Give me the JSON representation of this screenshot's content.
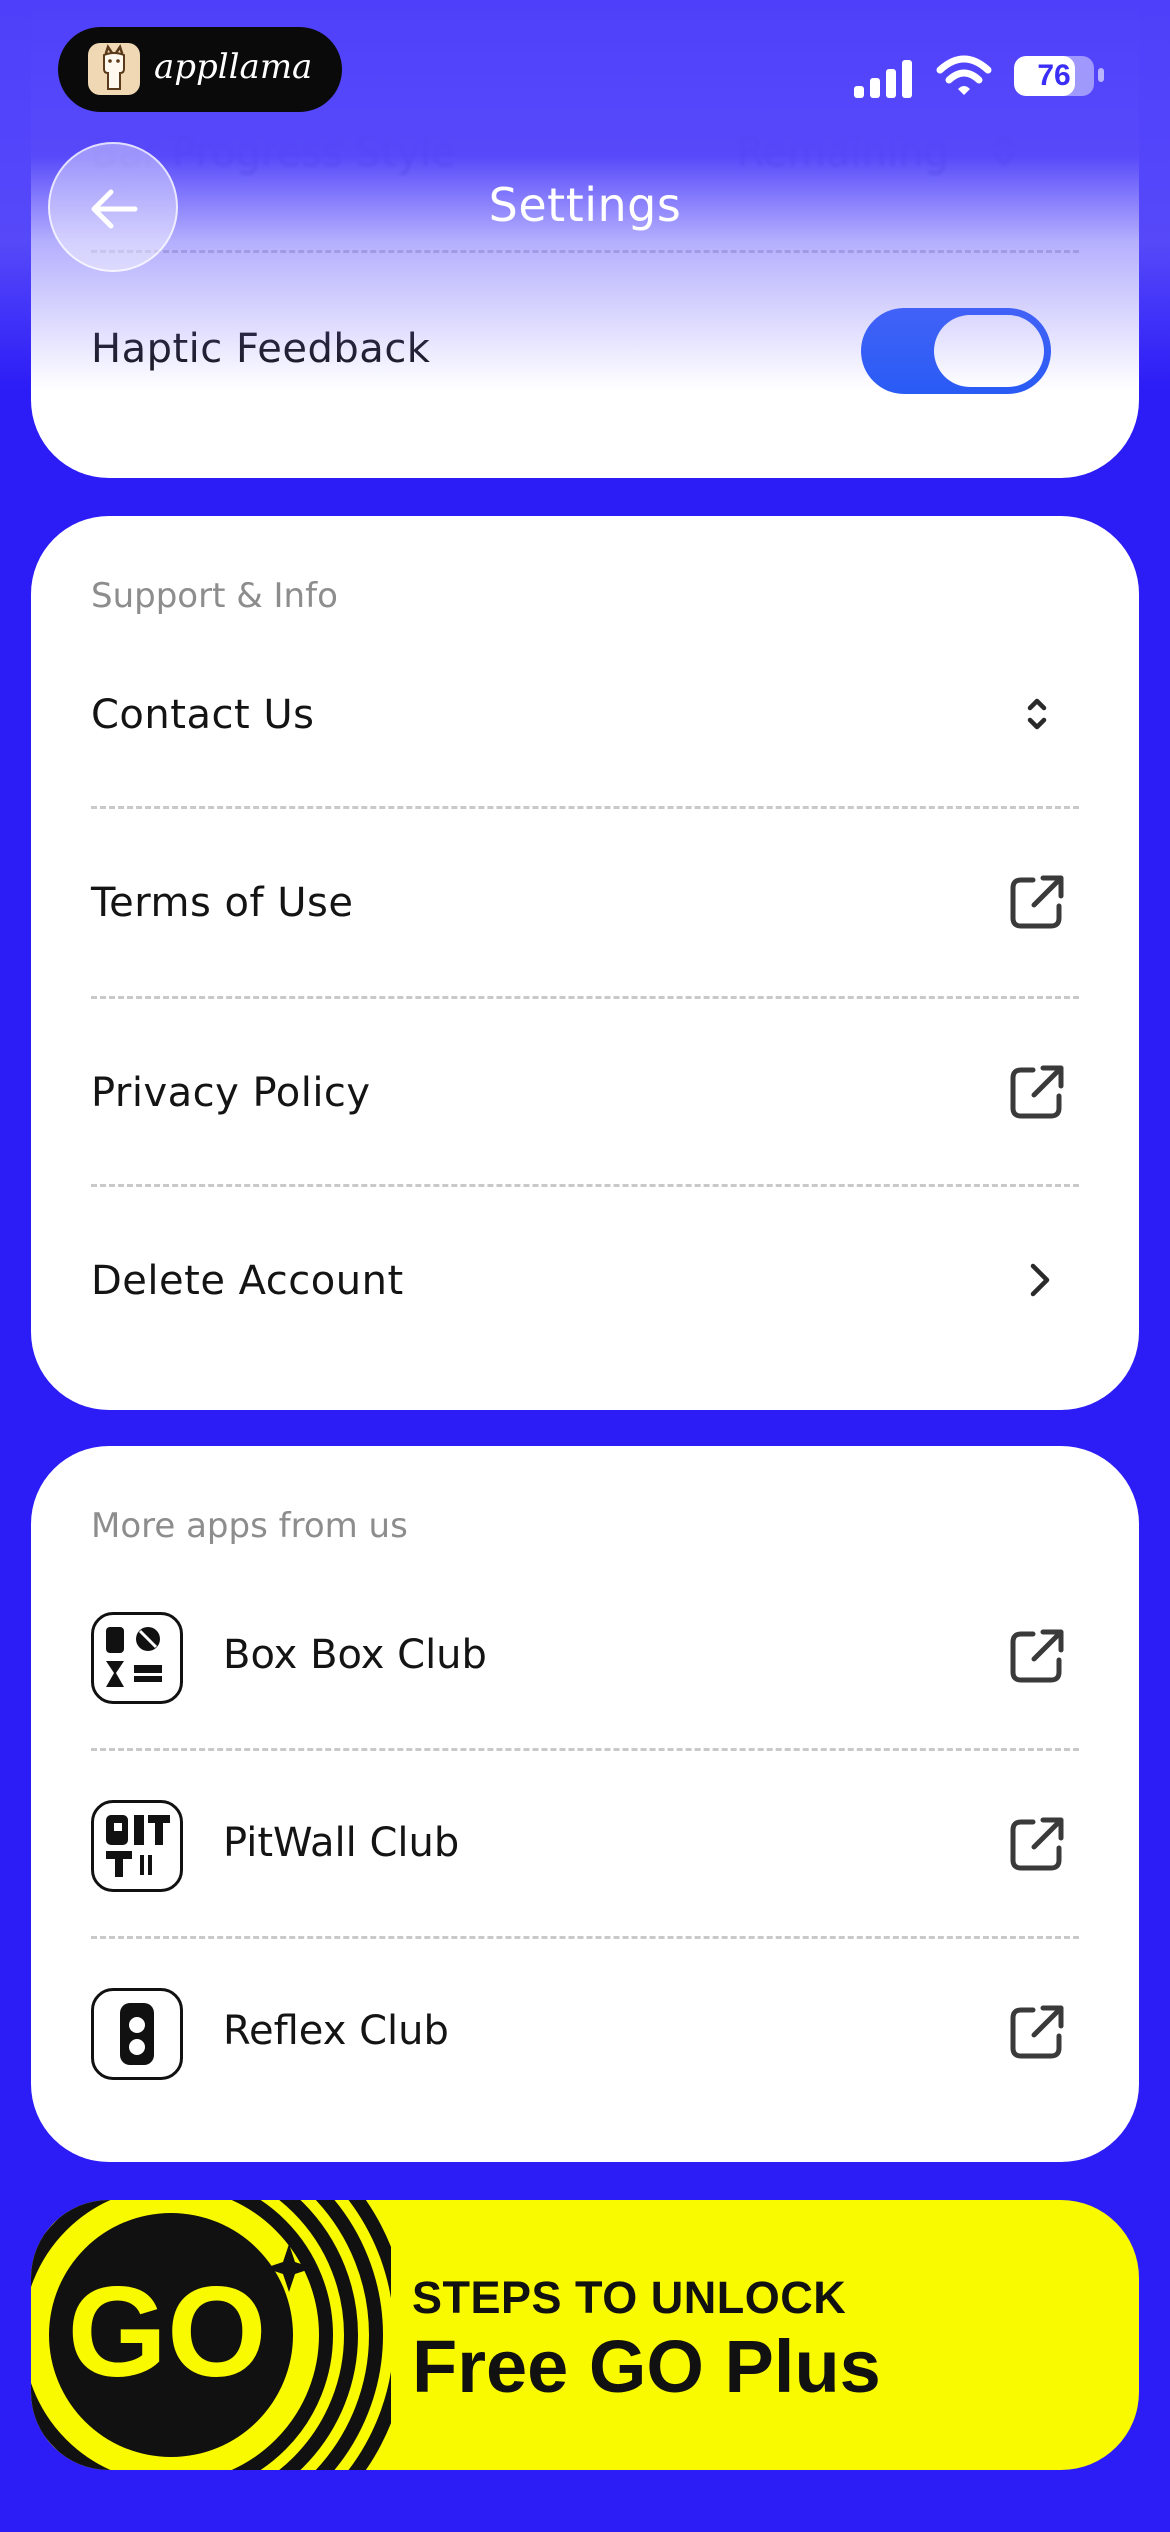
{
  "status_bar": {
    "brand": "appllama",
    "battery_level": "76"
  },
  "header": {
    "title": "Settings"
  },
  "preferences": {
    "ghost_row_label": "Bar Progress Style",
    "ghost_row_value": "Remaining",
    "haptic_label": "Haptic Feedback",
    "haptic_on": true
  },
  "support": {
    "section_title": "Support & Info",
    "items": [
      {
        "label": "Contact Us",
        "icon": "chevron-updown-icon"
      },
      {
        "label": "Terms of Use",
        "icon": "external-link-icon"
      },
      {
        "label": "Privacy Policy",
        "icon": "external-link-icon"
      },
      {
        "label": "Delete Account",
        "icon": "chevron-right-icon"
      }
    ]
  },
  "more_apps": {
    "section_title": "More apps from us",
    "items": [
      {
        "label": "Box Box Club",
        "icon": "box-box-club-logo"
      },
      {
        "label": "PitWall Club",
        "icon": "pitwall-club-logo"
      },
      {
        "label": "Reflex Club",
        "icon": "reflex-club-logo"
      }
    ]
  },
  "banner": {
    "logo_text": "GO",
    "small_text": "STEPS TO UNLOCK",
    "big_text": "Free GO Plus"
  },
  "colors": {
    "background": "#2c1cf6",
    "toggle_on": "#2a5cf5",
    "banner": "#f9fa00"
  }
}
